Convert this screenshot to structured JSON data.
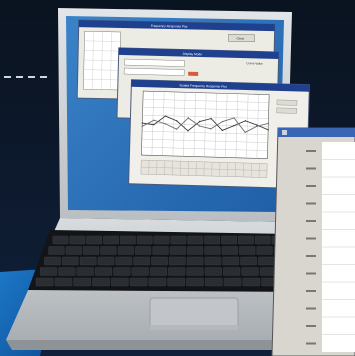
{
  "scene": {
    "subject": "laptop-displaying-graph-software-windows",
    "colors": {
      "background": "#0b1420",
      "desktop": "#2a6fb8",
      "bezel": "#cfd3d6",
      "accent_blue": "#1a6fbf",
      "window_title_bar": "#1f3f8f",
      "window_body": "#f0efe9"
    }
  },
  "windows": [
    {
      "title": "Frequency Response Plot",
      "button": "Close"
    },
    {
      "title": "Display Mode",
      "side_title": "Curve Value"
    },
    {
      "title": "Scaled Frequency Response Plot"
    }
  ],
  "chart_data": {
    "type": "line",
    "series": [
      {
        "values": [
          0.5,
          0.48,
          0.62,
          0.55,
          0.4,
          0.55,
          0.6,
          0.42,
          0.5,
          0.58,
          0.52,
          0.45
        ]
      },
      {
        "values": [
          0.45,
          0.55,
          0.5,
          0.42,
          0.6,
          0.48,
          0.44,
          0.56,
          0.62,
          0.4,
          0.5,
          0.55
        ]
      }
    ],
    "series_colors": [
      "#3d3d3d",
      "#6c6c6c"
    ]
  }
}
